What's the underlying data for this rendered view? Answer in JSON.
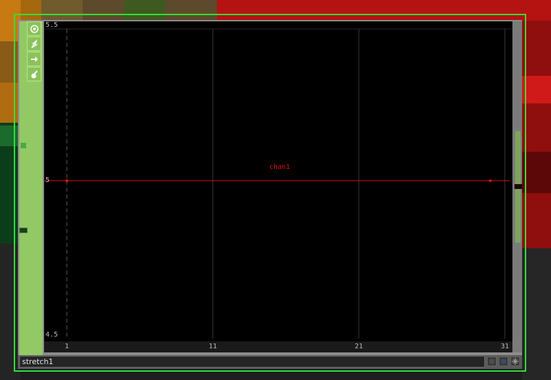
{
  "node": {
    "name": "stretch1",
    "flags": [
      {
        "name": "viewer-active-icon"
      },
      {
        "name": "cook-icon"
      },
      {
        "name": "bypass-icon"
      },
      {
        "name": "display-icon"
      }
    ]
  },
  "chart_data": {
    "type": "line",
    "title": "",
    "xlabel": "",
    "ylabel": "",
    "xlim": [
      0,
      31.5
    ],
    "ylim": [
      4.5,
      5.5
    ],
    "x_ticks": [
      "1",
      "11",
      "21",
      "31"
    ],
    "y_ticks": [
      "5.5",
      "5",
      "4.5"
    ],
    "series": [
      {
        "name": "chan1",
        "color": "#e01010",
        "x": [
          1,
          30
        ],
        "values": [
          5,
          5
        ]
      }
    ],
    "grid": true
  },
  "colors": {
    "selection": "#33e03a",
    "channel": "#e01010",
    "viewer_bg": "#000000"
  }
}
